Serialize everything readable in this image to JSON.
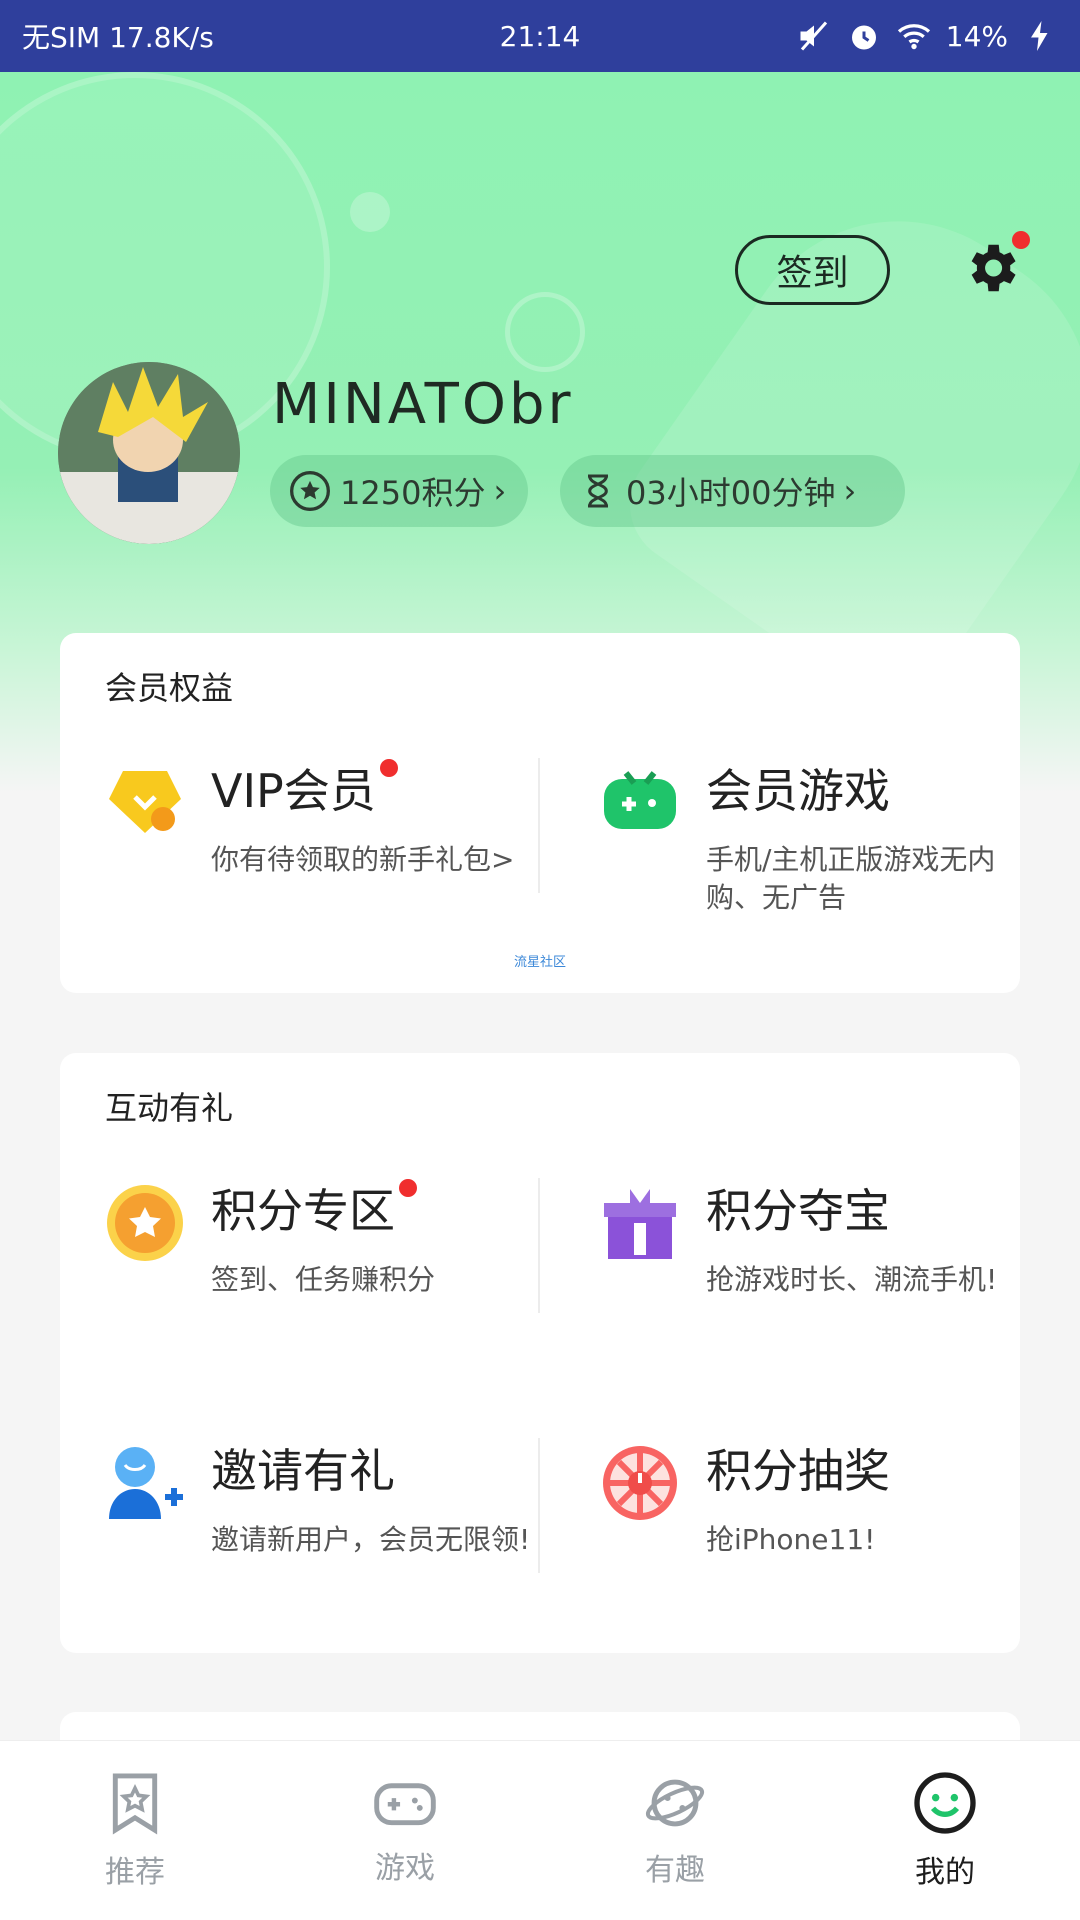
{
  "status_bar": {
    "left": "无SIM 17.8K/s",
    "time": "21:14",
    "battery": "14%"
  },
  "header": {
    "signin_label": "签到",
    "username": "MINATObr",
    "points": "1250积分",
    "time_left": "03小时00分钟"
  },
  "member_card": {
    "title": "会员权益",
    "items": [
      {
        "title": "VIP会员",
        "desc": "你有待领取的新手礼包>",
        "icon": "vip-diamond-icon"
      },
      {
        "title": "会员游戏",
        "desc": "手机/主机正版游戏无内购、无广告",
        "icon": "gamepad-icon"
      }
    ],
    "footer_link": "流星社区"
  },
  "interact_card": {
    "title": "互动有礼",
    "items": [
      {
        "title": "积分专区",
        "desc": "签到、任务赚积分",
        "icon": "star-coin-icon"
      },
      {
        "title": "积分夺宝",
        "desc": "抢游戏时长、潮流手机!",
        "icon": "gift-box-icon"
      },
      {
        "title": "邀请有礼",
        "desc": "邀请新用户，会员无限领!",
        "icon": "invite-user-icon"
      },
      {
        "title": "积分抽奖",
        "desc": "抢iPhone11!",
        "icon": "lottery-wheel-icon"
      }
    ]
  },
  "bottom_nav": {
    "items": [
      {
        "label": "推荐",
        "icon": "bookmark-star-icon"
      },
      {
        "label": "游戏",
        "icon": "gamepad-icon"
      },
      {
        "label": "有趣",
        "icon": "planet-icon"
      },
      {
        "label": "我的",
        "icon": "smiley-icon"
      }
    ],
    "active": "我的"
  },
  "colors": {
    "status_bar": "#2f3f9c",
    "header_green": "#8ff2b3",
    "accent_red": "#f02e2e",
    "active_nav": "#1d1d1d"
  }
}
